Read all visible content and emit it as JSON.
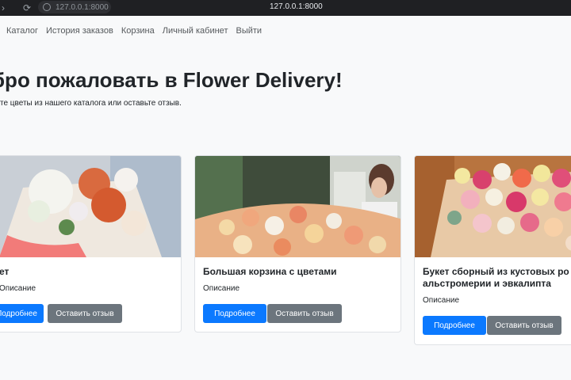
{
  "browser": {
    "address_short": "127.0.0.1:8000",
    "address_center": "127.0.0.1:8000"
  },
  "nav": {
    "items": [
      {
        "label": "Каталог"
      },
      {
        "label": "История заказов"
      },
      {
        "label": "Корзина"
      },
      {
        "label": "Личный кабинет"
      },
      {
        "label": "Выйти"
      }
    ]
  },
  "hero": {
    "title": "бро пожаловать в Flower Delivery!",
    "subtitle": "те цветы из нашего каталога или оставьте отзыв."
  },
  "cards": [
    {
      "title": "ет",
      "description": "Описание",
      "details_label": "Подробнее",
      "review_label": "Оставить отзыв"
    },
    {
      "title": "Большая корзина с цветами",
      "description": "Описание",
      "details_label": "Подробнее",
      "review_label": "Оставить отзыв"
    },
    {
      "title": "Букет сборный из кустовых ро\nальстромерии и эвкалипта",
      "description": "Описание",
      "details_label": "Подробнее",
      "review_label": "Оставить отзыв"
    }
  ],
  "colors": {
    "primary": "#0b79ff",
    "secondary": "#6c757d",
    "browser_bar": "#1f2023"
  }
}
